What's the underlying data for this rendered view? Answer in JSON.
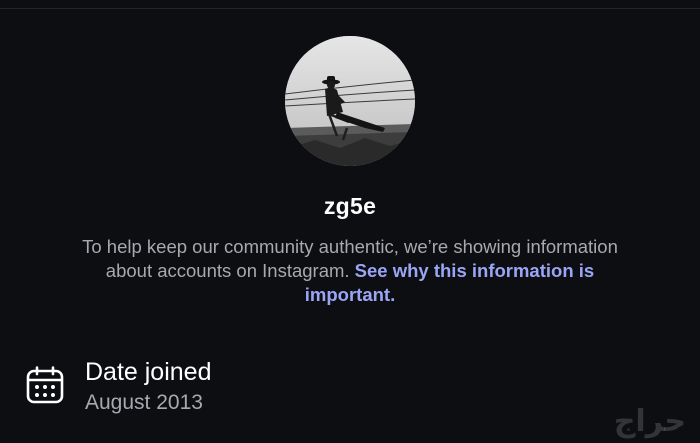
{
  "profile": {
    "username": "zg5e",
    "avatar_description": "profile-photo"
  },
  "about": {
    "text": "To help keep our community authentic, we’re showing information about accounts on Instagram. ",
    "link_text": "See why this information is important."
  },
  "date_joined": {
    "icon": "calendar-icon",
    "label": "Date joined",
    "value": "August 2013"
  },
  "watermark": {
    "text": "حراج"
  },
  "colors": {
    "background": "#0d0e12",
    "link": "#9aa6f5",
    "secondary_text": "#a8a8ae"
  }
}
